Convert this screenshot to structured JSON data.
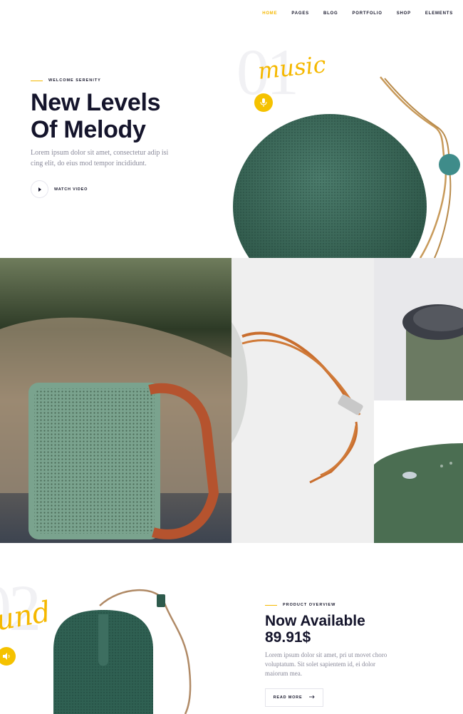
{
  "nav": {
    "items": [
      {
        "label": "HOME",
        "active": true
      },
      {
        "label": "PAGES"
      },
      {
        "label": "BLOG"
      },
      {
        "label": "PORTFOLIO"
      },
      {
        "label": "SHOP"
      },
      {
        "label": "ELEMENTS"
      }
    ]
  },
  "hero": {
    "kicker": "WELCOME SERENITY",
    "title_line1": "New Levels",
    "title_line2": "Of Melody",
    "body": "Lorem ipsum dolor sit amet, consectetur adip isi cing elit, do eius mod tempor incididunt.",
    "watch_label": "WATCH VIDEO",
    "big_number": "01",
    "script_word": "music",
    "mic_icon": "microphone-icon"
  },
  "product": {
    "big_number": "02",
    "script_word": "und",
    "speaker_icon": "speaker-icon",
    "kicker": "PRODUCT OVERVIEW",
    "title_line1": "Now Available",
    "title_line2": "89.91$",
    "body": "Lorem ipsum dolor sit amet, pri ut movet choro voluptatum. Sit solet sapientem id, ei dolor maiorum mea.",
    "read_more": "READ MORE"
  },
  "colors": {
    "accent": "#f5b800",
    "heading": "#14142b",
    "speaker_green": "#2e5a4c"
  }
}
